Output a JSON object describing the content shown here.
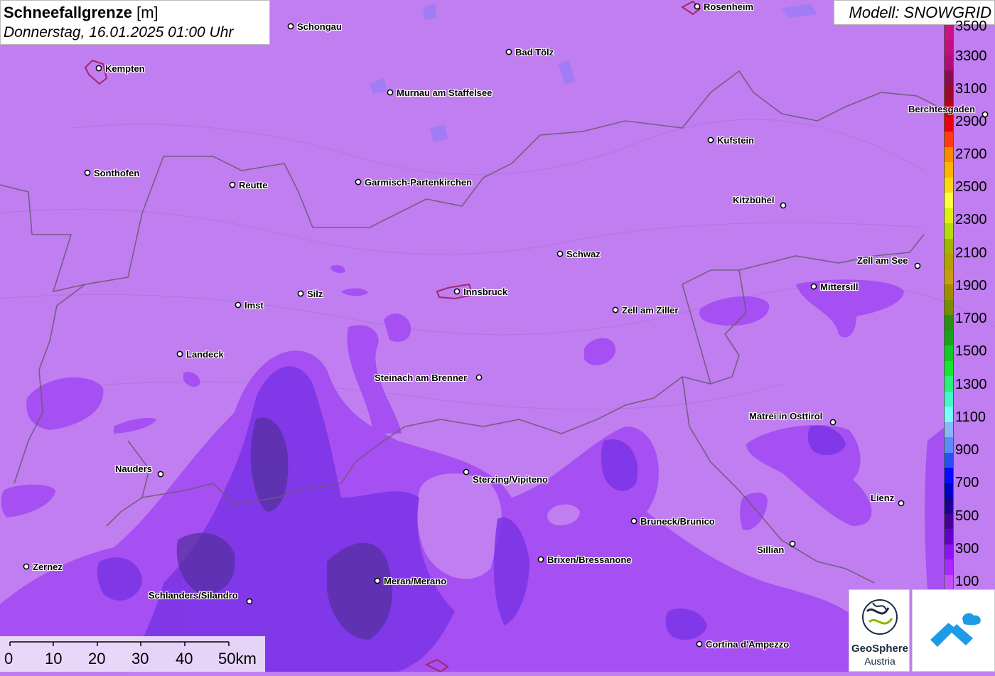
{
  "title": {
    "bold": "Schneefallgrenze",
    "unit": "[m]",
    "datetime": "Donnerstag, 16.01.2025 01:00 Uhr"
  },
  "model": "Modell: SNOWGRID",
  "legend": {
    "labels": [
      "3500",
      "3300",
      "3100",
      "2900",
      "2700",
      "2500",
      "2300",
      "2100",
      "1900",
      "1700",
      "1500",
      "1300",
      "1100",
      "900",
      "700",
      "500",
      "300",
      "100"
    ],
    "colors": [
      "#c81482",
      "#c01080",
      "#b00c76",
      "#8c0a50",
      "#9b0a2a",
      "#c00018",
      "#e60010",
      "#ff3c14",
      "#ff8a00",
      "#ffb400",
      "#ffd814",
      "#ffff3c",
      "#dcf014",
      "#b4dc0a",
      "#a0b400",
      "#b4a000",
      "#c89b14",
      "#a08c00",
      "#788c00",
      "#2d8c14",
      "#19a01e",
      "#14c828",
      "#19e632",
      "#28f078",
      "#46f5c8",
      "#78ffff",
      "#8cb4ff",
      "#5a8cff",
      "#2850f0",
      "#0a0aff",
      "#0000c8",
      "#1e0096",
      "#460096",
      "#6400c8",
      "#8c14f0",
      "#aa28ff",
      "#c050ff"
    ]
  },
  "cities": [
    {
      "name": "Rosenheim"
    },
    {
      "name": "Schongau"
    },
    {
      "name": "Kempten"
    },
    {
      "name": "Bad Tölz"
    },
    {
      "name": "Murnau am Staffelsee"
    },
    {
      "name": "Berchtesgaden"
    },
    {
      "name": "Kufstein"
    },
    {
      "name": "Sonthofen"
    },
    {
      "name": "Reutte"
    },
    {
      "name": "Garmisch-Partenkirchen"
    },
    {
      "name": "Kitzbühel"
    },
    {
      "name": "Schwaz"
    },
    {
      "name": "Zell am See"
    },
    {
      "name": "Mittersill"
    },
    {
      "name": "Imst"
    },
    {
      "name": "Silz"
    },
    {
      "name": "Innsbruck"
    },
    {
      "name": "Zell am Ziller"
    },
    {
      "name": "Landeck"
    },
    {
      "name": "Steinach am Brenner"
    },
    {
      "name": "Matrei in Osttirol"
    },
    {
      "name": "Nauders"
    },
    {
      "name": "Sterzing/Vipiteno"
    },
    {
      "name": "Lienz"
    },
    {
      "name": "Bruneck/Brunico"
    },
    {
      "name": "Sillian"
    },
    {
      "name": "Brixen/Bressanone"
    },
    {
      "name": "Zernez"
    },
    {
      "name": "Meran/Merano"
    },
    {
      "name": "Schlanders/Silandro"
    },
    {
      "name": "Cortina d'Ampezzo"
    }
  ],
  "scale": {
    "labels": [
      "0",
      "10",
      "20",
      "30",
      "40",
      "50km"
    ]
  },
  "logos": {
    "geosphere_name": "GeoSphere",
    "geosphere_sub": "Austria"
  },
  "colors": {
    "base_map": "#c07ef0",
    "mid_snowline": "#a050f0",
    "low_snowline": "#7a34e0",
    "lowest_snowline": "#52309c",
    "border": "#6e5a78",
    "city_outline": "#a0286e"
  }
}
